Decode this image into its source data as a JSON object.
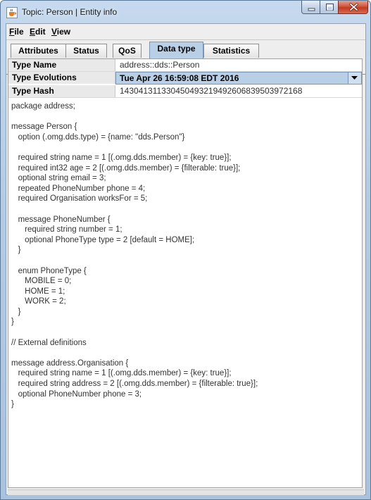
{
  "window": {
    "title": "Topic: Person | Entity info",
    "icon": "java-cup-icon"
  },
  "menu": [
    {
      "label": "File",
      "mnemonic": "F",
      "rest": "ile"
    },
    {
      "label": "Edit",
      "mnemonic": "E",
      "rest": "dit"
    },
    {
      "label": "View",
      "mnemonic": "V",
      "rest": "iew"
    }
  ],
  "tabs": [
    {
      "label": "Attributes",
      "active": false
    },
    {
      "label": "Status",
      "active": false
    },
    {
      "label": "QoS",
      "active": false
    },
    {
      "label": "Data type",
      "active": true
    },
    {
      "label": "Statistics",
      "active": false
    }
  ],
  "info": {
    "type_name_label": "Type Name",
    "type_name_value": "address::dds::Person",
    "type_evolutions_label": "Type Evolutions",
    "type_evolutions_value": "Tue Apr 26 16:59:08 EDT 2016",
    "type_hash_label": "Type Hash",
    "type_hash_value": "14304131133045049321949260683950397216​8"
  },
  "code": "package address;\n\nmessage Person {\n   option (.omg.dds.type) = {name: \"dds.Person\"}\n\n   required string name = 1 [(.omg.dds.member) = {key: true}];\n   required int32 age = 2 [(.omg.dds.member) = {filterable: true}];\n   optional string email = 3;\n   repeated PhoneNumber phone = 4;\n   required Organisation worksFor = 5;\n\n   message PhoneNumber {\n      required string number = 1;\n      optional PhoneType type = 2 [default = HOME];\n   }\n\n   enum PhoneType {\n      MOBILE = 0;\n      HOME = 1;\n      WORK = 2;\n   }\n}\n\n// External definitions\n\nmessage address.Organisation {\n   required string name = 1 [(.omg.dds.member) = {key: true}];\n   required string address = 2 [(.omg.dds.member) = {filterable: true}];\n   optional PhoneNumber phone = 3;\n}"
}
